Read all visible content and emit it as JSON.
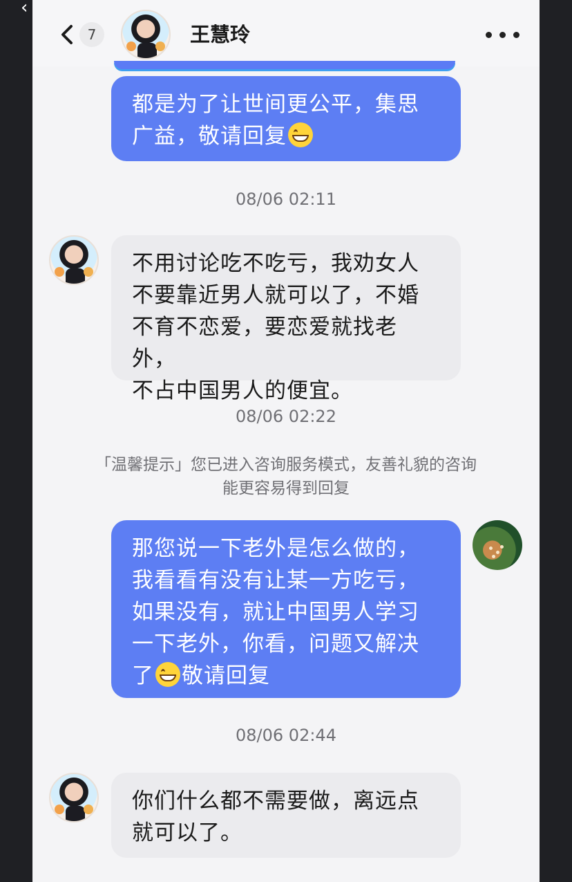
{
  "header": {
    "unread_count": "7",
    "title": "王慧玲"
  },
  "messages": [
    {
      "sender": "self",
      "text": "都是为了让世间更公平，集思\n广益，敬请回复"
    },
    {
      "sender": "peer",
      "text": "不用讨论吃不吃亏，我劝女人\n不要靠近男人就可以了，不婚\n不育不恋爱，要恋爱就找老外，\n不占中国男人的便宜。"
    },
    {
      "sender": "self",
      "text_before": "那您说一下老外是怎么做的，\n我看看有没有让某一方吃亏，\n如果没有，就让中国男人学习\n一下老外，你看，问题又解决\n了",
      "text_after": "敬请回复"
    },
    {
      "sender": "peer",
      "text": "你们什么都不需要做，离远点\n就可以了。"
    }
  ],
  "timestamps": [
    "08/06 02:11",
    "08/06 02:22",
    "08/06 02:44"
  ],
  "notice": "「温馨提示」您已进入咨询服务模式，友善礼貌的咨询能更容易得到回复",
  "icons": {
    "emoji": "grinning-face-emoji",
    "back": "chevron-left-icon",
    "more": "more-dots-icon"
  },
  "colors": {
    "self_bubble": "#5d7ef3",
    "peer_bubble": "#ebebee",
    "background": "#f4f4f6"
  }
}
